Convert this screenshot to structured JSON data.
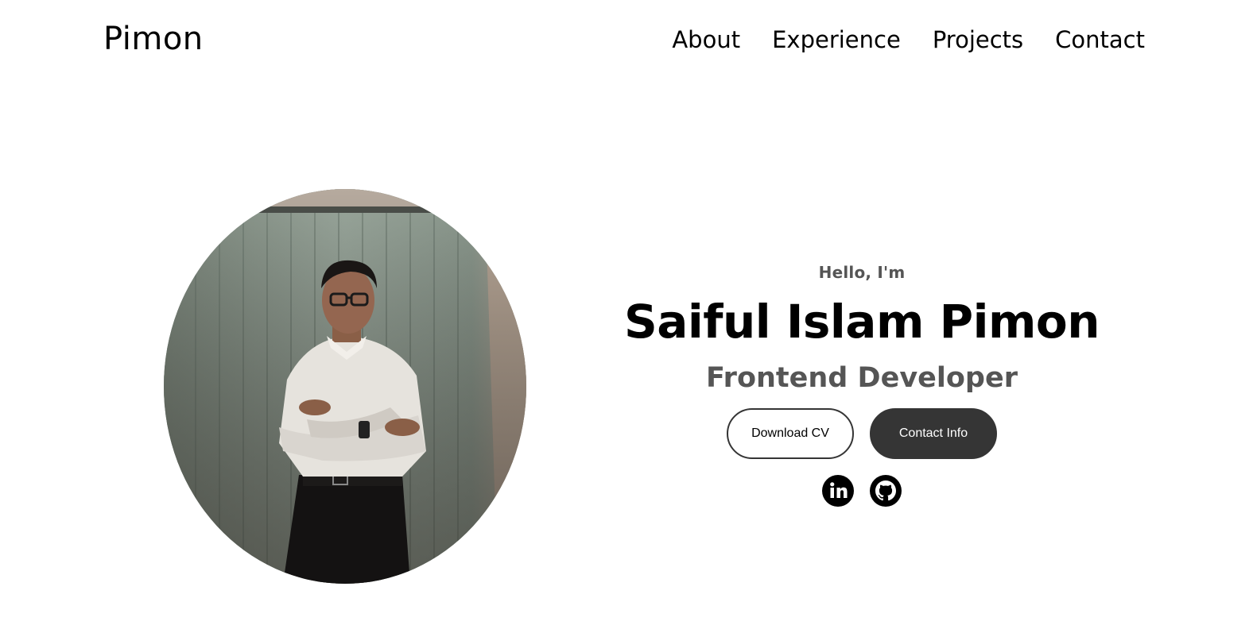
{
  "nav": {
    "logo": "Pimon",
    "links": [
      "About",
      "Experience",
      "Projects",
      "Contact"
    ]
  },
  "hero": {
    "greeting": "Hello, I'm",
    "name": "Saiful Islam Pimon",
    "role": "Frontend Developer",
    "buttons": {
      "download_cv": "Download CV",
      "contact_info": "Contact Info"
    },
    "socials": [
      {
        "icon": "linkedin-icon"
      },
      {
        "icon": "github-icon"
      }
    ]
  },
  "colors": {
    "text": "#000000",
    "muted": "#555555",
    "button_dark": "#353535",
    "background": "#ffffff"
  }
}
